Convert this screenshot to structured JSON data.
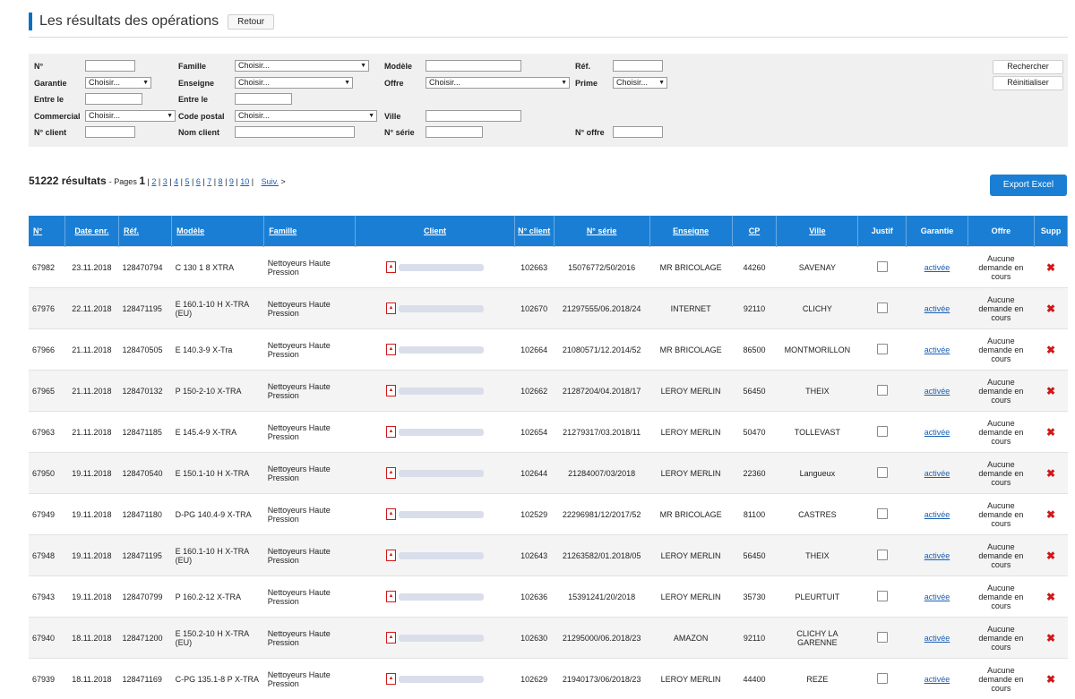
{
  "header": {
    "title": "Les résultats des opérations",
    "back_label": "Retour"
  },
  "filters": {
    "labels": {
      "num": "N°",
      "garantie": "Garantie",
      "entre_le_1": "Entre le",
      "commercial": "Commercial",
      "num_client": "N° client",
      "famille": "Famille",
      "enseigne": "Enseigne",
      "entre_le_2": "Entre le",
      "code_postal": "Code postal",
      "nom_client": "Nom client",
      "modele": "Modèle",
      "offre": "Offre",
      "ville": "Ville",
      "num_serie": "N° série",
      "ref": "Réf.",
      "prime": "Prime",
      "num_offre": "N° offre"
    },
    "select_default": "Choisir...",
    "search_label": "Rechercher",
    "reset_label": "Réinitialiser"
  },
  "results": {
    "count": "51222 résultats",
    "pages_prefix": "- Pages",
    "current_page": "1",
    "pages": [
      "2",
      "3",
      "4",
      "5",
      "6",
      "7",
      "8",
      "9",
      "10"
    ],
    "next_label": "Suiv.",
    "export_label": "Export Excel"
  },
  "columns": [
    "N°",
    "Date enr.",
    "Réf.",
    "Modèle",
    "Famille",
    "Client",
    "N° client",
    "N° série",
    "Enseigne",
    "CP",
    "Ville",
    "Justif",
    "Garantie",
    "Offre",
    "Supp"
  ],
  "rows": [
    {
      "num": "67982",
      "date": "23.11.2018",
      "ref": "128470794",
      "modele": "C 130 1 8 XTRA",
      "famille": "Nettoyeurs Haute Pression",
      "num_client": "102663",
      "serie": "15076772/50/2016",
      "enseigne": "MR BRICOLAGE",
      "cp": "44260",
      "ville": "SAVENAY",
      "garantie": "activée",
      "offre": "Aucune demande en cours"
    },
    {
      "num": "67976",
      "date": "22.11.2018",
      "ref": "128471195",
      "modele": "E 160.1-10 H X-TRA (EU)",
      "famille": "Nettoyeurs Haute Pression",
      "num_client": "102670",
      "serie": "21297555/06.2018/24",
      "enseigne": "INTERNET",
      "cp": "92110",
      "ville": "CLICHY",
      "garantie": "activée",
      "offre": "Aucune demande en cours"
    },
    {
      "num": "67966",
      "date": "21.11.2018",
      "ref": "128470505",
      "modele": "E 140.3-9 X-Tra",
      "famille": "Nettoyeurs Haute Pression",
      "num_client": "102664",
      "serie": "21080571/12.2014/52",
      "enseigne": "MR BRICOLAGE",
      "cp": "86500",
      "ville": "MONTMORILLON",
      "garantie": "activée",
      "offre": "Aucune demande en cours"
    },
    {
      "num": "67965",
      "date": "21.11.2018",
      "ref": "128470132",
      "modele": "P 150-2-10 X-TRA",
      "famille": "Nettoyeurs Haute Pression",
      "num_client": "102662",
      "serie": "21287204/04.2018/17",
      "enseigne": "LEROY MERLIN",
      "cp": "56450",
      "ville": "THEIX",
      "garantie": "activée",
      "offre": "Aucune demande en cours"
    },
    {
      "num": "67963",
      "date": "21.11.2018",
      "ref": "128471185",
      "modele": "E 145.4-9 X-TRA",
      "famille": "Nettoyeurs Haute Pression",
      "num_client": "102654",
      "serie": "21279317/03.2018/11",
      "enseigne": "LEROY MERLIN",
      "cp": "50470",
      "ville": "TOLLEVAST",
      "garantie": "activée",
      "offre": "Aucune demande en cours"
    },
    {
      "num": "67950",
      "date": "19.11.2018",
      "ref": "128470540",
      "modele": "E 150.1-10 H X-TRA",
      "famille": "Nettoyeurs Haute Pression",
      "num_client": "102644",
      "serie": "21284007/03/2018",
      "enseigne": "LEROY MERLIN",
      "cp": "22360",
      "ville": "Langueux",
      "garantie": "activée",
      "offre": "Aucune demande en cours"
    },
    {
      "num": "67949",
      "date": "19.11.2018",
      "ref": "128471180",
      "modele": "D-PG 140.4-9 X-TRA",
      "famille": "Nettoyeurs Haute Pression",
      "num_client": "102529",
      "serie": "22296981/12/2017/52",
      "enseigne": "MR BRICOLAGE",
      "cp": "81100",
      "ville": "CASTRES",
      "garantie": "activée",
      "offre": "Aucune demande en cours"
    },
    {
      "num": "67948",
      "date": "19.11.2018",
      "ref": "128471195",
      "modele": "E 160.1-10 H X-TRA (EU)",
      "famille": "Nettoyeurs Haute Pression",
      "num_client": "102643",
      "serie": "21263582/01.2018/05",
      "enseigne": "LEROY MERLIN",
      "cp": "56450",
      "ville": "THEIX",
      "garantie": "activée",
      "offre": "Aucune demande en cours"
    },
    {
      "num": "67943",
      "date": "19.11.2018",
      "ref": "128470799",
      "modele": "P 160.2-12 X-TRA",
      "famille": "Nettoyeurs Haute Pression",
      "num_client": "102636",
      "serie": "15391241/20/2018",
      "enseigne": "LEROY MERLIN",
      "cp": "35730",
      "ville": "PLEURTUIT",
      "garantie": "activée",
      "offre": "Aucune demande en cours"
    },
    {
      "num": "67940",
      "date": "18.11.2018",
      "ref": "128471200",
      "modele": "E 150.2-10 H X-TRA (EU)",
      "famille": "Nettoyeurs Haute Pression",
      "num_client": "102630",
      "serie": "21295000/06.2018/23",
      "enseigne": "AMAZON",
      "cp": "92110",
      "ville": "CLICHY LA GARENNE",
      "garantie": "activée",
      "offre": "Aucune demande en cours"
    },
    {
      "num": "67939",
      "date": "18.11.2018",
      "ref": "128471169",
      "modele": "C-PG 135.1-8 P X-TRA",
      "famille": "Nettoyeurs Haute Pression",
      "num_client": "102629",
      "serie": "21940173/06/2018/23",
      "enseigne": "LEROY MERLIN",
      "cp": "44400",
      "ville": "REZE",
      "garantie": "activée",
      "offre": "Aucune demande en cours"
    }
  ],
  "colors": {
    "accent": "#1a7fd4",
    "delete": "#d01818",
    "link": "#1a5fb4"
  },
  "icons": {
    "client_doc": "pdf-icon",
    "justif": "document-icon",
    "supp": "delete-icon"
  }
}
